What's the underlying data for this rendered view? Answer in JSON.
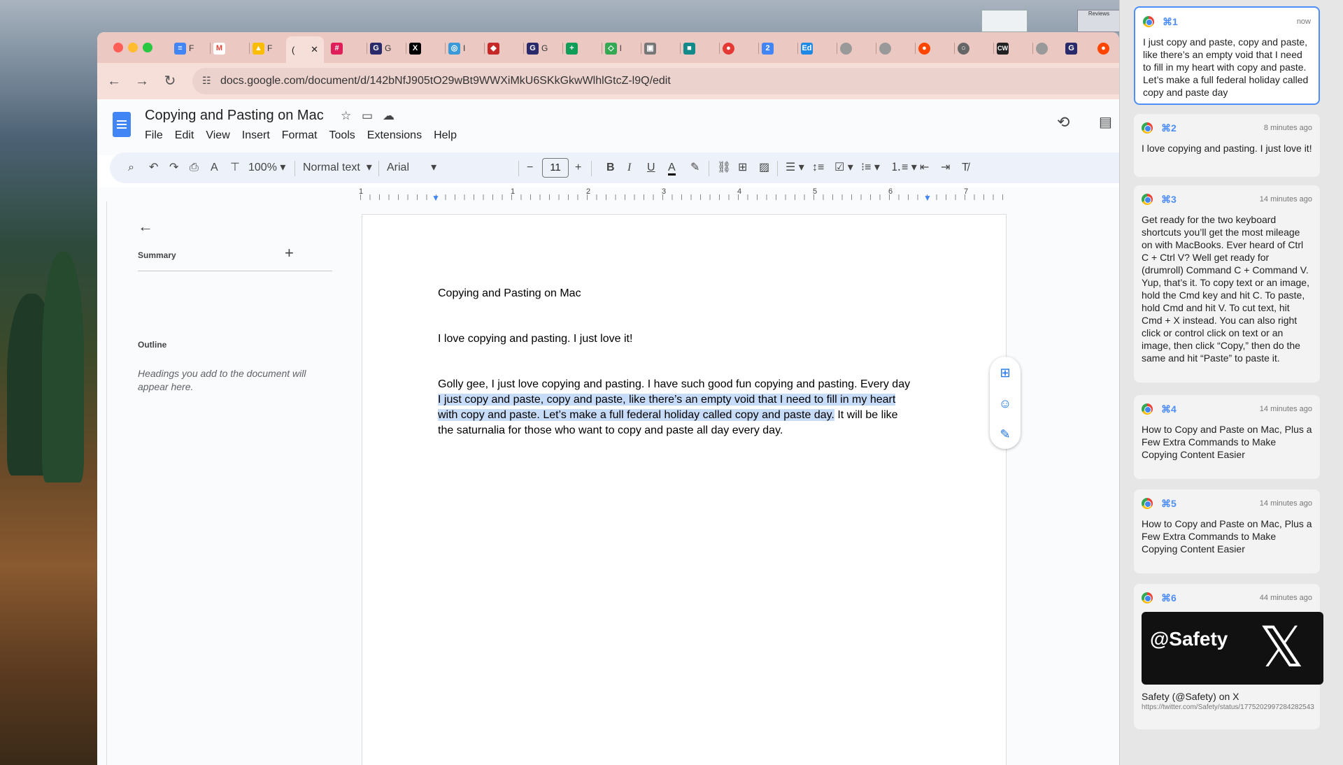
{
  "browser": {
    "url": "docs.google.com/document/d/142bNfJ905tO29wBt9WWXiMkU6SKkGkwWlhlGtcZ-l9Q/edit",
    "active_tab_label": "(",
    "tabs": [
      "F",
      "",
      "F",
      "",
      "G",
      "",
      "I",
      "",
      "G",
      "",
      "l",
      "",
      "",
      "",
      "",
      "",
      "",
      "",
      "",
      "",
      "",
      "",
      "",
      "",
      ""
    ]
  },
  "desktop": {
    "mini_window_label": "Reviews"
  },
  "doc": {
    "title": "Copying and Pasting on Mac",
    "menu": [
      "File",
      "Edit",
      "View",
      "Insert",
      "Format",
      "Tools",
      "Extensions",
      "Help"
    ],
    "zoom": "100%",
    "style": "Normal text",
    "font": "Arial",
    "font_size": "11",
    "ruler": [
      "1",
      "1",
      "2",
      "3",
      "4",
      "5",
      "6",
      "7"
    ],
    "outline": {
      "summary": "Summary",
      "outline": "Outline",
      "hint": "Headings you add to the document will appear here."
    },
    "body": {
      "heading": "Copying and Pasting on Mac",
      "line2": "I love copying and pasting. I just love it!",
      "p3_line1": "Golly gee, I just love copying and pasting. I have such good fun copying and pasting. Every day",
      "p3_hl1": "I just copy and paste, copy and paste, like there’s an empty void that I need to fill in my heart",
      "p3_hl2": "with copy and paste. Let’s make a full federal holiday called copy and paste day.",
      "p3_rest2": " It will be like",
      "p3_line4": "the saturnalia for those who want to copy and paste all day every day."
    }
  },
  "clipboard": [
    {
      "key": "⌘1",
      "time": "now",
      "text": "I just copy and paste, copy and paste, like there’s an empty void that I need to fill in my heart with copy and paste. Let’s make a full federal holiday called copy and paste day"
    },
    {
      "key": "⌘2",
      "time": "8 minutes ago",
      "text": "I love copying and pasting. I just love it!"
    },
    {
      "key": "⌘3",
      "time": "14 minutes ago",
      "text": "Get ready for the two keyboard shortcuts you’ll get the most mileage on with MacBooks. Ever heard of Ctrl C + Ctrl V? Well get ready for (drumroll) Command C + Command V. Yup, that’s it. To copy text or an image, hold the Cmd key and hit C. To paste, hold Cmd and hit V. To cut text, hit Cmd + X instead. You can also right click or control click on text or an image, then click “Copy,” then do the same and hit “Paste” to paste it."
    },
    {
      "key": "⌘4",
      "time": "14 minutes ago",
      "text": "How to Copy and Paste on Mac, Plus a Few Extra Commands to Make Copying Content Easier"
    },
    {
      "key": "⌘5",
      "time": "14 minutes ago",
      "text": "How to Copy and Paste on Mac, Plus a Few Extra Commands to Make Copying Content Easier"
    },
    {
      "key": "⌘6",
      "time": "44 minutes ago",
      "card_handle": "@Safety",
      "card_logo": "𝕏",
      "source_title": "Safety (@Safety) on X",
      "source_url": "https://twitter.com/Safety/status/1775202997284282543"
    }
  ]
}
